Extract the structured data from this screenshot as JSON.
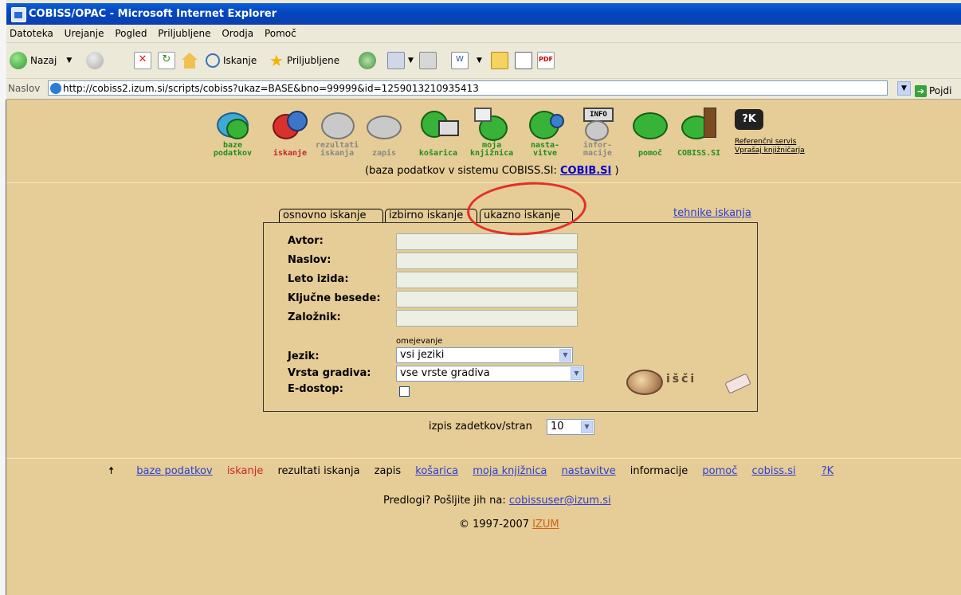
{
  "window": {
    "title": "COBISS/OPAC - Microsoft Internet Explorer"
  },
  "menu": [
    "Datoteka",
    "Urejanje",
    "Pogled",
    "Priljubljene",
    "Orodja",
    "Pomoč"
  ],
  "toolbar": {
    "back_label": "Nazaj",
    "search_label": "Iskanje",
    "favorites_label": "Priljubljene"
  },
  "address": {
    "label": "Naslov",
    "url": "http://cobiss2.izum.si/scripts/cobiss?ukaz=BASE&bno=99999&id=1259013210935413",
    "go_label": "Pojdi"
  },
  "nav": {
    "items": [
      {
        "label1": "baze",
        "label2": "podatkov"
      },
      {
        "label1": "",
        "label2": "iskanje"
      },
      {
        "label1": "rezultati",
        "label2": "iskanja"
      },
      {
        "label1": "",
        "label2": "zapis"
      },
      {
        "label1": "",
        "label2": "košarica"
      },
      {
        "label1": "moja",
        "label2": "knjižnica"
      },
      {
        "label1": "nasta-",
        "label2": "vitve"
      },
      {
        "label1": "infor-",
        "label2": "macije"
      },
      {
        "label1": "",
        "label2": "pomoč"
      },
      {
        "label1": "",
        "label2": "COBISS.SI"
      }
    ],
    "qk_badge": "?K",
    "ref_service": "Referenčni servis",
    "ask_librarian": "Vprašaj knjižničarja"
  },
  "db_info": {
    "prefix": "(baza podatkov v sistemu COBISS.SI: ",
    "db": "COBIB.SI",
    "suffix": " )"
  },
  "tabs": [
    "osnovno iskanje",
    "izbirno iskanje",
    "ukazno iskanje"
  ],
  "tech_link": "tehnike iskanja",
  "form": {
    "fields": [
      "Avtor:",
      "Naslov:",
      "Leto izida:",
      "Ključne besede:",
      "Založnik:"
    ],
    "limit_label": "omejevanje",
    "language_label": "Jezik:",
    "language_value": "vsi jeziki",
    "material_label": "Vrsta gradiva:",
    "material_value": "vse vrste gradiva",
    "eaccess_label": "E-dostop:",
    "search_button": "išči"
  },
  "paging": {
    "label": "izpis zadetkov/stran",
    "value": "10"
  },
  "bottom_nav": [
    "baze podatkov",
    "iskanje",
    "rezultati iskanja",
    "zapis",
    "košarica",
    "moja knjižnica",
    "nastavitve",
    "informacije",
    "pomoč",
    "cobiss.si",
    "?K"
  ],
  "footer": {
    "suggest_prefix": "Predlogi? Pošljite jih na: ",
    "email": "cobissuser@izum.si",
    "copyright": "© 1997-2007 ",
    "izum": "IZUM"
  }
}
